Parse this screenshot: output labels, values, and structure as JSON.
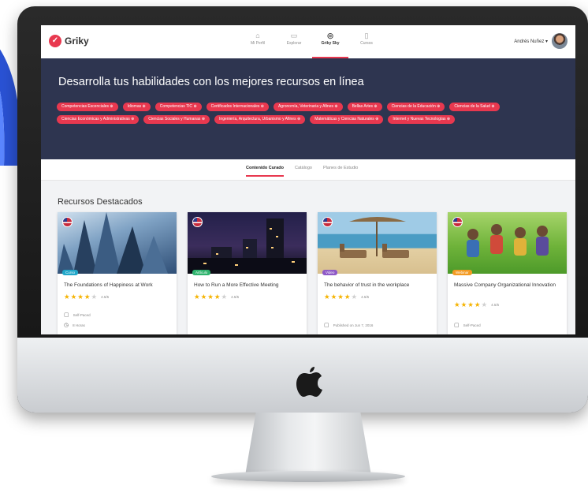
{
  "app": {
    "logo_text": "Griky"
  },
  "nav": [
    {
      "label": "Mi Perfil",
      "icon": "home-icon"
    },
    {
      "label": "Explorar",
      "icon": "book-icon"
    },
    {
      "label": "Griky Sky",
      "icon": "target-icon",
      "active": true
    },
    {
      "label": "Cursos",
      "icon": "document-icon"
    }
  ],
  "user": {
    "name": "Andrés Nuñez ▾"
  },
  "hero": {
    "title": "Desarrolla tus habilidades con los mejores recursos en línea",
    "chips": [
      "Competencias Escenciales",
      "Idiomas",
      "Competencias TIC",
      "Certificados Internacionales",
      "Agronomía, Veterinaria y Afines",
      "Bellas Artes",
      "Ciencias de la Educación",
      "Ciencias de la Salud",
      "Ciencias Económicas y Administrativas",
      "Ciencias Sociales y Humanas",
      "Ingeniería, Arquitectura, Urbanismo y Afines",
      "Matemáticas y Ciencias Naturales",
      "Internet y Nuevas Tecnologías"
    ]
  },
  "tabs": [
    {
      "label": "Contenido Curado",
      "active": true
    },
    {
      "label": "Catálogo"
    },
    {
      "label": "Planes de Estudio"
    }
  ],
  "section": {
    "title": "Recursos Destacados"
  },
  "colors": {
    "accent": "#e8384f",
    "hero_bg": "#2e3550"
  },
  "cards": [
    {
      "badge": "Curso",
      "badge_color": "#21a7c9",
      "title": "The Foundations of Happiness at Work",
      "stars": 4,
      "rating": "4.5/5",
      "meta1": "Self-Paced",
      "meta2": "8 Horas"
    },
    {
      "badge": "Artículo",
      "badge_color": "#2fb36d",
      "title": "How to Run a More Effective Meeting",
      "stars": 4,
      "rating": "4.5/5"
    },
    {
      "badge": "Video",
      "badge_color": "#8e59c7",
      "title": "The behavior of trust in the workplace",
      "stars": 4,
      "rating": "4.5/5",
      "meta1": "Published on Jun 7, 2016"
    },
    {
      "badge": "Webinar",
      "badge_color": "#f39a22",
      "title": "Massive Company Organizational Innovation",
      "stars": 4,
      "rating": "4.5/5",
      "meta1": "Self-Paced"
    }
  ]
}
